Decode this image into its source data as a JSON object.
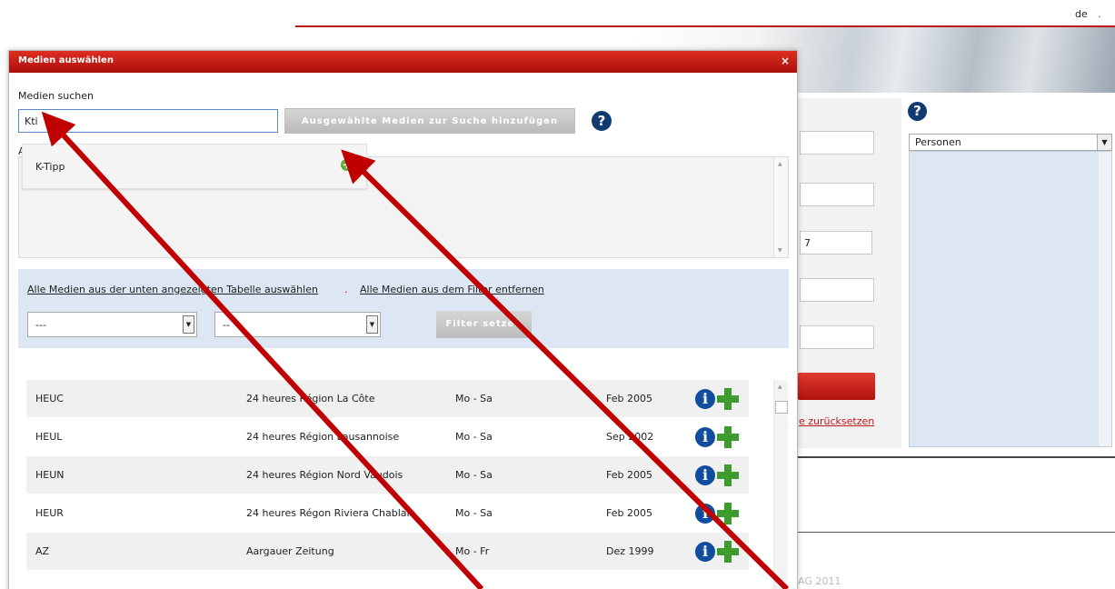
{
  "header": {
    "language": "de",
    "language_dot": "."
  },
  "background": {
    "input_value": "7",
    "reset_link": "e zurücksetzen",
    "select_value": "Personen",
    "copyright": "AG 2011"
  },
  "modal": {
    "title": "Medien auswählen",
    "close_icon": "×",
    "search_label": "Medien suchen",
    "search_value": "Kti",
    "add_button": "Ausgewählte Medien zur Suche hinzufügen",
    "help_icon": "?",
    "selected_label": "A",
    "dropdown": {
      "item": "K-Tipp",
      "add_icon": "+"
    },
    "filter": {
      "link_select_all": "Alle Medien aus der unten angezeigten Tabelle auswählen",
      "separator": ".",
      "link_remove_all": "Alle Medien aus dem Filter entfernen",
      "select1_value": "---",
      "select2_value": "--",
      "apply_button": "Filter setzen"
    },
    "table": {
      "rows": [
        {
          "code": "HEUC",
          "name": "24 heures Région La Côte",
          "days": "Mo - Sa",
          "date": "Feb 2005"
        },
        {
          "code": "HEUL",
          "name": "24 heures Région Lausannoise",
          "days": "Mo - Sa",
          "date": "Sep 2002"
        },
        {
          "code": "HEUN",
          "name": "24 heures Région Nord Vaudois",
          "days": "Mo - Sa",
          "date": "Feb 2005"
        },
        {
          "code": "HEUR",
          "name": "24 heures Régon Riviera Chablais",
          "days": "Mo - Sa",
          "date": "Feb 2005"
        },
        {
          "code": "AZ",
          "name": "Aargauer Zeitung",
          "days": "Mo - Fr",
          "date": "Dez 1999"
        }
      ]
    }
  },
  "colors": {
    "brand_red": "#c0171b",
    "annotation_red": "#c00000",
    "filter_bg": "#dde7f3",
    "add_green": "#3e9b2e"
  },
  "icons": [
    "help-icon",
    "close-icon",
    "add-circle-icon",
    "info-icon",
    "plus-icon"
  ]
}
